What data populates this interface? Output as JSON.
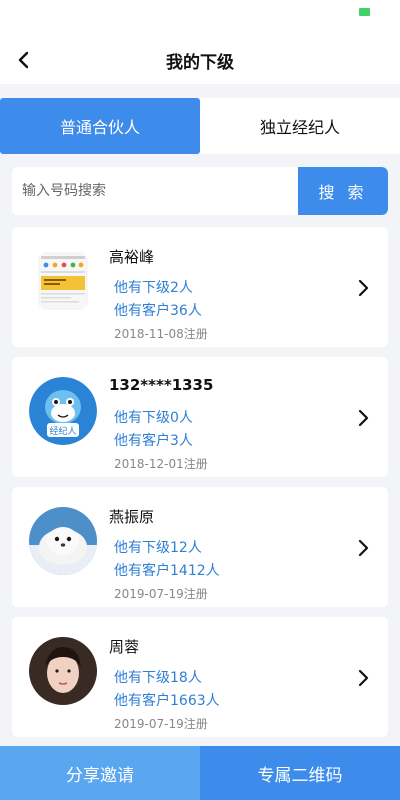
{
  "colors": {
    "accent": "#3d8bea",
    "link_blue": "#2f7fd6",
    "battery_green": "#3fd26b"
  },
  "header": {
    "title": "我的下级",
    "back_icon": "chevron-left-icon"
  },
  "tabs": [
    {
      "label": "普通合伙人",
      "active": true
    },
    {
      "label": "独立经纪人",
      "active": false
    }
  ],
  "search": {
    "placeholder": "输入号码搜索",
    "button_label": "搜 索"
  },
  "members": [
    {
      "name": "高裕峰",
      "subordinates": "他有下级2人",
      "customers": "他有客户36人",
      "registered": "2018-11-08注册",
      "avatar": "screenshot-thumbnail"
    },
    {
      "name": "132****1335",
      "subordinates": "他有下级0人",
      "customers": "他有客户3人",
      "registered": "2018-12-01注册",
      "avatar": "dolphin-mascot",
      "avatar_text": "经纪人"
    },
    {
      "name": "燕振原",
      "subordinates": "他有下级12人",
      "customers": "他有客户1412人",
      "registered": "2019-07-19注册",
      "avatar": "seal-photo"
    },
    {
      "name": "周蓉",
      "subordinates": "他有下级18人",
      "customers": "他有客户1663人",
      "registered": "2019-07-19注册",
      "avatar": "portrait-photo"
    }
  ],
  "bottom": {
    "share_label": "分享邀请",
    "qr_label": "专属二维码"
  }
}
